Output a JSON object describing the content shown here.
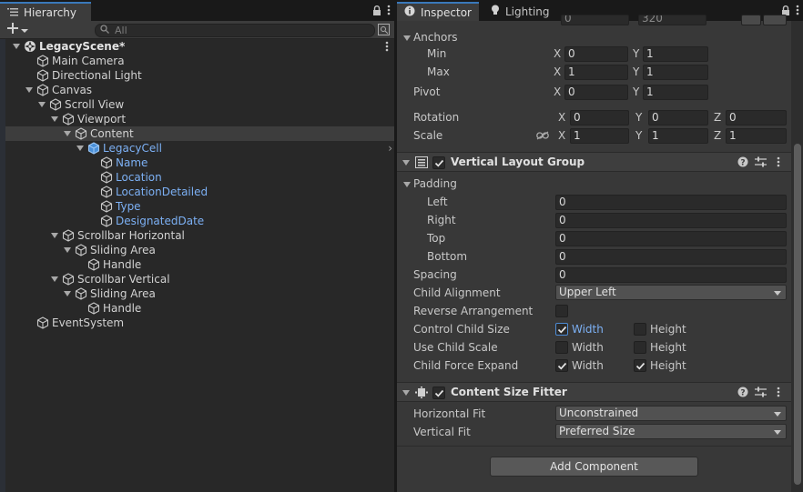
{
  "hierarchy": {
    "tab_label": "Hierarchy",
    "search_placeholder": "All",
    "items": [
      {
        "label": "LegacyScene*",
        "depth": 0,
        "kind": "scene",
        "expanded": true
      },
      {
        "label": "Main Camera",
        "depth": 1,
        "kind": "object"
      },
      {
        "label": "Directional Light",
        "depth": 1,
        "kind": "object"
      },
      {
        "label": "Canvas",
        "depth": 1,
        "kind": "object",
        "expanded": true
      },
      {
        "label": "Scroll View",
        "depth": 2,
        "kind": "object",
        "expanded": true
      },
      {
        "label": "Viewport",
        "depth": 3,
        "kind": "object",
        "expanded": true
      },
      {
        "label": "Content",
        "depth": 4,
        "kind": "object",
        "expanded": true,
        "selected": true
      },
      {
        "label": "LegacyCell",
        "depth": 5,
        "kind": "prefab",
        "expanded": true,
        "has_children_arrow": true
      },
      {
        "label": "Name",
        "depth": 6,
        "kind": "prefab-child"
      },
      {
        "label": "Location",
        "depth": 6,
        "kind": "prefab-child"
      },
      {
        "label": "LocationDetailed",
        "depth": 6,
        "kind": "prefab-child"
      },
      {
        "label": "Type",
        "depth": 6,
        "kind": "prefab-child"
      },
      {
        "label": "DesignatedDate",
        "depth": 6,
        "kind": "prefab-child"
      },
      {
        "label": "Scrollbar Horizontal",
        "depth": 3,
        "kind": "object",
        "expanded": true
      },
      {
        "label": "Sliding Area",
        "depth": 4,
        "kind": "object",
        "expanded": true
      },
      {
        "label": "Handle",
        "depth": 5,
        "kind": "object"
      },
      {
        "label": "Scrollbar Vertical",
        "depth": 3,
        "kind": "object",
        "expanded": true
      },
      {
        "label": "Sliding Area",
        "depth": 4,
        "kind": "object",
        "expanded": true
      },
      {
        "label": "Handle",
        "depth": 5,
        "kind": "object"
      },
      {
        "label": "EventSystem",
        "depth": 1,
        "kind": "object"
      }
    ]
  },
  "inspector": {
    "tab_inspector": "Inspector",
    "tab_lighting": "Lighting",
    "top_partial": {
      "a": "0",
      "b": "320"
    },
    "anchors": {
      "label": "Anchors",
      "min_label": "Min",
      "min_x": "0",
      "min_y": "1",
      "max_label": "Max",
      "max_x": "1",
      "max_y": "1"
    },
    "pivot": {
      "label": "Pivot",
      "x": "0",
      "y": "1"
    },
    "rotation": {
      "label": "Rotation",
      "x": "0",
      "y": "0",
      "z": "0"
    },
    "scale": {
      "label": "Scale",
      "x": "1",
      "y": "1",
      "z": "1"
    },
    "axis": {
      "x": "X",
      "y": "Y",
      "z": "Z"
    },
    "vlg": {
      "title": "Vertical Layout Group",
      "padding_label": "Padding",
      "left_label": "Left",
      "left": "0",
      "right_label": "Right",
      "right": "0",
      "top_label": "Top",
      "top": "0",
      "bottom_label": "Bottom",
      "bottom": "0",
      "spacing_label": "Spacing",
      "spacing": "0",
      "child_alignment_label": "Child Alignment",
      "child_alignment": "Upper Left",
      "reverse_label": "Reverse Arrangement",
      "control_size_label": "Control Child Size",
      "use_scale_label": "Use Child Scale",
      "force_expand_label": "Child Force Expand",
      "width_label": "Width",
      "height_label": "Height"
    },
    "csf": {
      "title": "Content Size Fitter",
      "hfit_label": "Horizontal Fit",
      "hfit": "Unconstrained",
      "vfit_label": "Vertical Fit",
      "vfit": "Preferred Size"
    },
    "add_component": "Add Component"
  }
}
